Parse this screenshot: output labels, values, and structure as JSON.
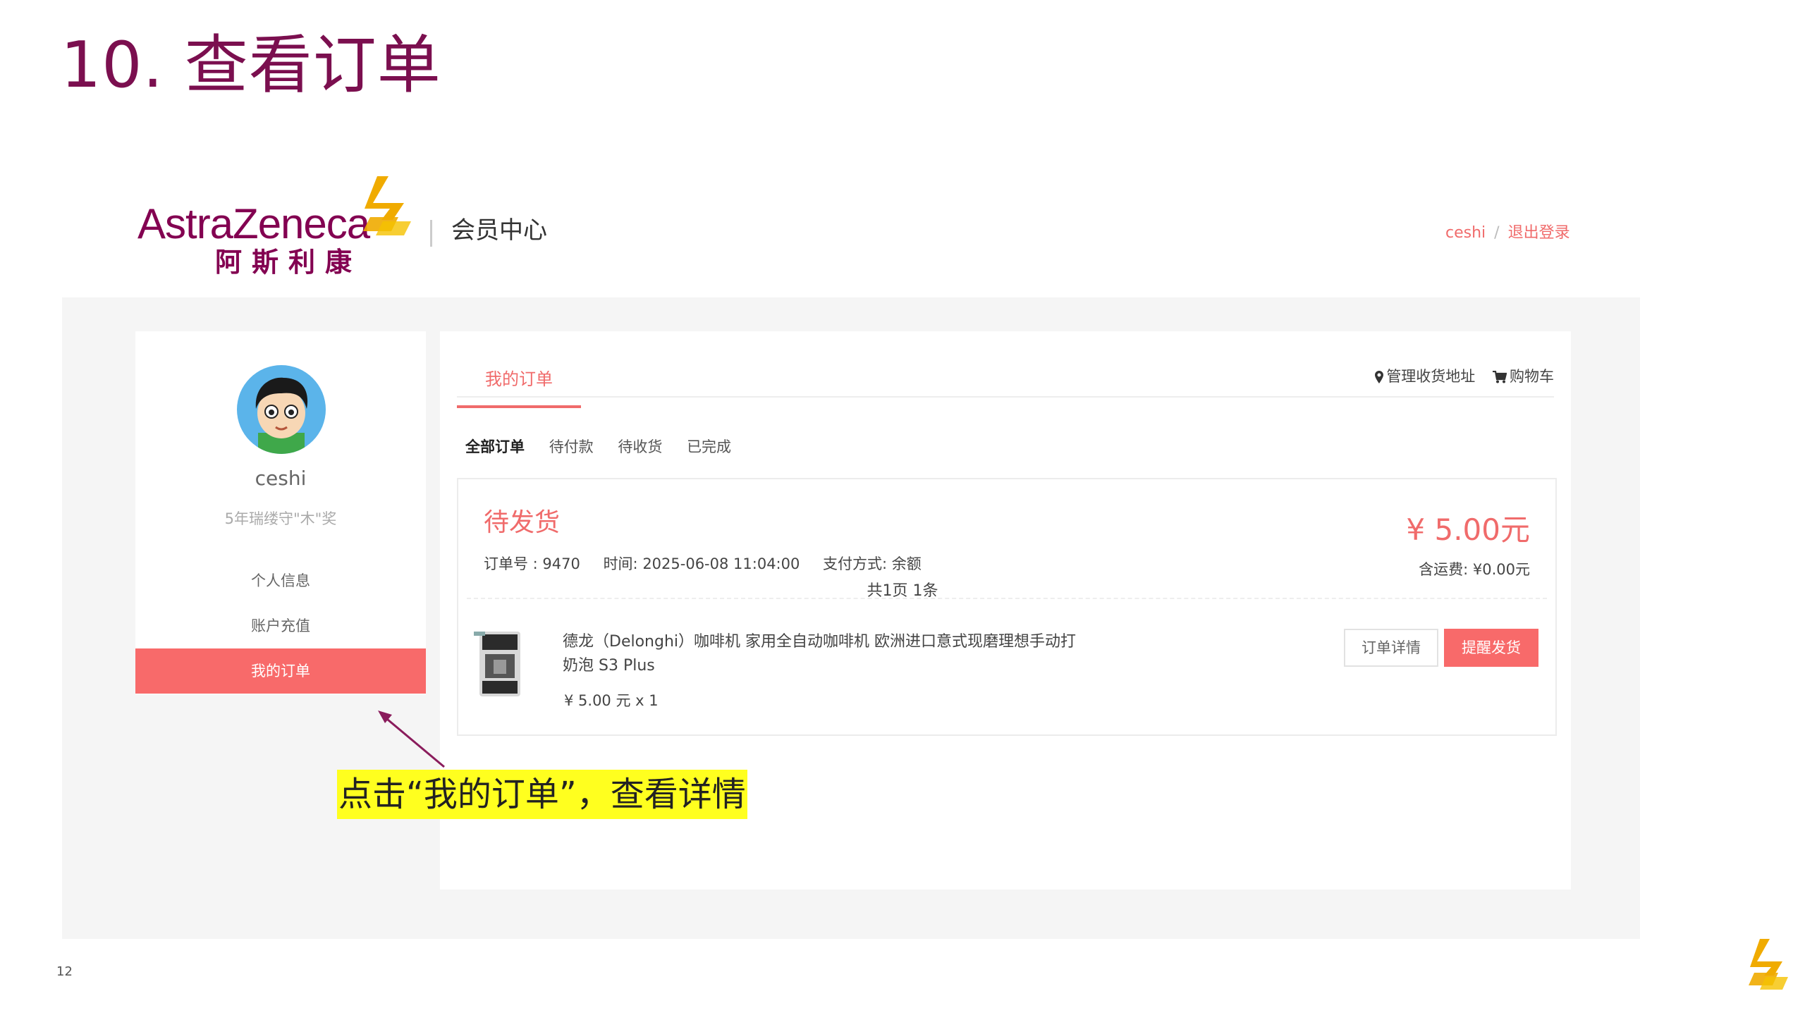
{
  "slide": {
    "title": "10. 查看订单",
    "page_number": "12"
  },
  "header": {
    "brand_en": "AstraZeneca",
    "brand_cn": "阿斯利康",
    "section": "会员中心",
    "user": "ceshi",
    "separator": "/",
    "logout": "退出登录"
  },
  "sidebar": {
    "username": "ceshi",
    "subtitle": "5年瑞缕守\"木\"奖",
    "items": [
      {
        "label": "个人信息",
        "active": false
      },
      {
        "label": "账户充值",
        "active": false
      },
      {
        "label": "我的订单",
        "active": true
      }
    ]
  },
  "content": {
    "tab": "我的订单",
    "links": [
      {
        "icon": "map-marker-icon",
        "label": "管理收货地址"
      },
      {
        "icon": "cart-icon",
        "label": "购物车"
      }
    ],
    "filters": [
      {
        "label": "全部订单",
        "active": true
      },
      {
        "label": "待付款",
        "active": false
      },
      {
        "label": "待收货",
        "active": false
      },
      {
        "label": "已完成",
        "active": false
      }
    ],
    "order": {
      "status": "待发货",
      "number": "订单号 : 9470",
      "time": "时间: 2025-06-08 11:04:00",
      "payment": "支付方式: 余额",
      "total": "¥ 5.00元",
      "shipping": "含运费: ¥0.00元",
      "product_name": "德龙（Delonghi）咖啡机 家用全自动咖啡机 欧洲进口意式现磨理想手动打奶泡 S3 Plus",
      "product_price": "¥ 5.00 元 x 1",
      "detail_button": "订单详情",
      "remind_button": "提醒发货"
    },
    "pagination": "共1页 1条"
  },
  "annotation": {
    "text": "点击“我的订单”，查看详情"
  },
  "colors": {
    "brand": "#830051",
    "title": "#7b0f4f",
    "accent": "#f86a6a",
    "highlight": "#ffff1f"
  }
}
